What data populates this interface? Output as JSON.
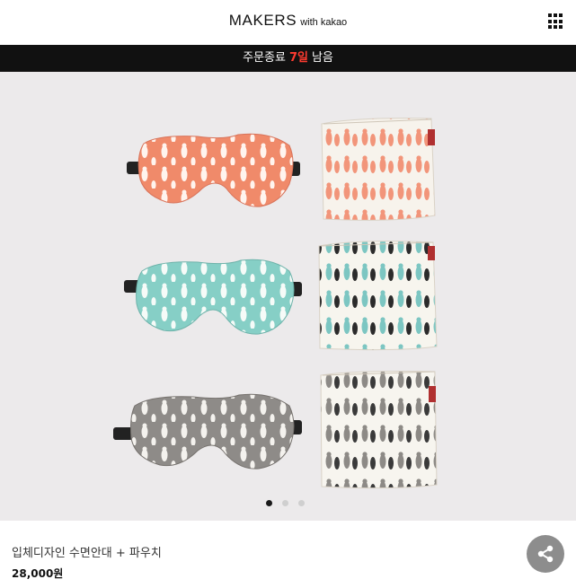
{
  "header": {
    "brand": "MAKERS",
    "brand_sub": "with kakao",
    "menu_icon": "grid-menu-icon"
  },
  "banner": {
    "prefix": "주문종료",
    "days": "7일",
    "suffix": "남음",
    "days_color": "#ff3b30"
  },
  "hero": {
    "slides_total": 3,
    "active_slide": 1
  },
  "product": {
    "title": "입체디자인 수면안대 + 파우치",
    "price": "28,000원"
  },
  "share": {
    "icon": "share-icon"
  }
}
